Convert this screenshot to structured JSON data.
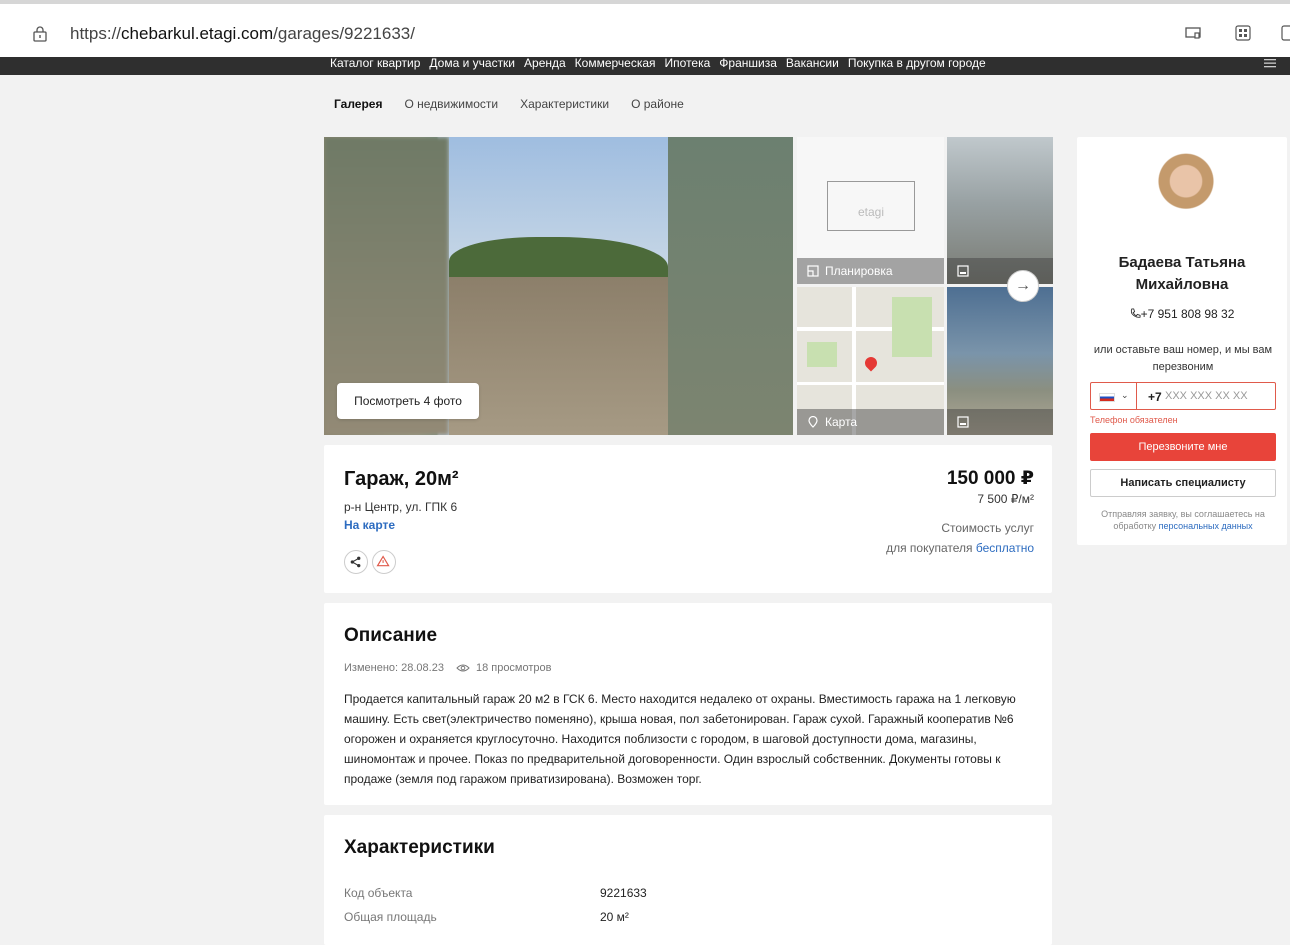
{
  "browser": {
    "url_prefix": "https://",
    "url_host": "chebarkul.etagi.com",
    "url_path": "/garages/9221633/"
  },
  "topnav": {
    "items": [
      "Каталог квартир",
      "Дома и участки",
      "Аренда",
      "Коммерческая",
      "Ипотека",
      "Франшиза",
      "Вакансии",
      "Покупка в другом городе"
    ]
  },
  "tabs": [
    "Галерея",
    "О недвижимости",
    "Характеристики",
    "О районе"
  ],
  "gallery": {
    "view_photos_label": "Посмотреть 4 фото",
    "plan_logo": "etagi",
    "plan_label": "Планировка",
    "map_label": "Карта",
    "next_arrow": "→"
  },
  "listing": {
    "title": "Гараж, 20м²",
    "address": "р-н Центр, ул. ГПК 6",
    "map_link": "На карте",
    "price": "150 000 ₽",
    "price_per_sqm": "7 500 ₽/м²",
    "service_line1": "Стоимость услуг",
    "service_line2": "для покупателя",
    "service_free": "бесплатно"
  },
  "description": {
    "heading": "Описание",
    "changed": "Изменено: 28.08.23",
    "views": "18 просмотров",
    "text": "Продается капитальный гараж 20 м2 в ГСК 6. Место находится недалеко от охраны. Вместимость гаража на 1 легковую машину. Есть свет(электричество поменяно), крыша новая, пол забетонирован. Гараж сухой. Гаражный кооператив №6 огорожен и охраняется круглосуточно. Находится поблизости с городом, в шаговой доступности дома, магазины, шиномонтаж и прочее. Показ по предварительной договоренности. Один взрослый собственник. Документы готовы к продаже (земля под гаражом приватизирована). Возможен торг."
  },
  "characteristics": {
    "heading": "Характеристики",
    "rows": [
      {
        "key": "Код объекта",
        "value": "9221633"
      },
      {
        "key": "Общая площадь",
        "value": "20 м²"
      }
    ]
  },
  "agent": {
    "name_line1": "Бадаева Татьяна",
    "name_line2": "Михайловна",
    "phone": "+7 951 808 98 32",
    "hint": "или оставьте ваш номер, и мы вам перезвоним",
    "phone_code": "+7",
    "phone_placeholder": "XXX XXX XX XX",
    "error": "Телефон обязателен",
    "call_button": "Перезвоните мне",
    "write_button": "Написать специалисту",
    "agree_text": "Отправляя заявку, вы соглашаетесь на обработку",
    "agree_link": "персональных данных"
  },
  "colors": {
    "accent_red": "#e8443a",
    "link_blue": "#2d6cc0",
    "nav_dark": "#2f2f2f"
  }
}
